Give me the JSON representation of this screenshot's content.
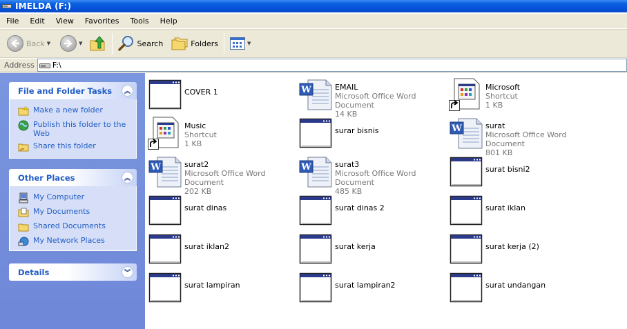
{
  "window": {
    "title": "IMELDA (F:)"
  },
  "menu": [
    "File",
    "Edit",
    "View",
    "Favorites",
    "Tools",
    "Help"
  ],
  "toolbar": {
    "back_label": "Back",
    "search_label": "Search",
    "folders_label": "Folders"
  },
  "address": {
    "label": "Address",
    "value": "F:\\"
  },
  "tasks_panel": {
    "title": "File and Folder Tasks",
    "items": [
      {
        "label": "Make a new folder"
      },
      {
        "label": "Publish this folder to the Web"
      },
      {
        "label": "Share this folder"
      }
    ]
  },
  "places_panel": {
    "title": "Other Places",
    "items": [
      {
        "label": "My Computer"
      },
      {
        "label": "My Documents"
      },
      {
        "label": "Shared Documents"
      },
      {
        "label": "My Network Places"
      }
    ]
  },
  "details_panel": {
    "title": "Details"
  },
  "files": [
    {
      "name": "COVER 1",
      "type": "",
      "size": "",
      "icon": "blank-window-icon"
    },
    {
      "name": "EMAIL",
      "type": "Microsoft Office Word Document",
      "size": "14 KB",
      "icon": "word-doc-icon"
    },
    {
      "name": "Microsoft",
      "type": "Shortcut",
      "size": "1 KB",
      "icon": "shortcut-icon"
    },
    {
      "name": "Music",
      "type": "Shortcut",
      "size": "1 KB",
      "icon": "shortcut-icon"
    },
    {
      "name": "surar bisnis",
      "type": "",
      "size": "",
      "icon": "blank-window-icon"
    },
    {
      "name": "surat",
      "type": "Microsoft Office Word Document",
      "size": "801 KB",
      "icon": "word-doc-icon"
    },
    {
      "name": "surat2",
      "type": "Microsoft Office Word Document",
      "size": "202 KB",
      "icon": "word-doc-icon"
    },
    {
      "name": "surat3",
      "type": "Microsoft Office Word Document",
      "size": "485 KB",
      "icon": "word-doc-icon"
    },
    {
      "name": "surat bisni2",
      "type": "",
      "size": "",
      "icon": "blank-window-icon"
    },
    {
      "name": "surat dinas",
      "type": "",
      "size": "",
      "icon": "blank-window-icon"
    },
    {
      "name": "surat dinas 2",
      "type": "",
      "size": "",
      "icon": "blank-window-icon"
    },
    {
      "name": "surat iklan",
      "type": "",
      "size": "",
      "icon": "blank-window-icon"
    },
    {
      "name": "surat iklan2",
      "type": "",
      "size": "",
      "icon": "blank-window-icon"
    },
    {
      "name": "surat kerja",
      "type": "",
      "size": "",
      "icon": "blank-window-icon"
    },
    {
      "name": "surat kerja (2)",
      "type": "",
      "size": "",
      "icon": "blank-window-icon"
    },
    {
      "name": "surat lampiran",
      "type": "",
      "size": "",
      "icon": "blank-window-icon"
    },
    {
      "name": "surat lampiran2",
      "type": "",
      "size": "",
      "icon": "blank-window-icon"
    },
    {
      "name": "surat undangan",
      "type": "",
      "size": "",
      "icon": "blank-window-icon"
    }
  ],
  "colors": {
    "titlebar": "#0a5fe0",
    "left_panel": "#7a96df",
    "task_link": "#215dc6",
    "chrome": "#ece9d8"
  }
}
